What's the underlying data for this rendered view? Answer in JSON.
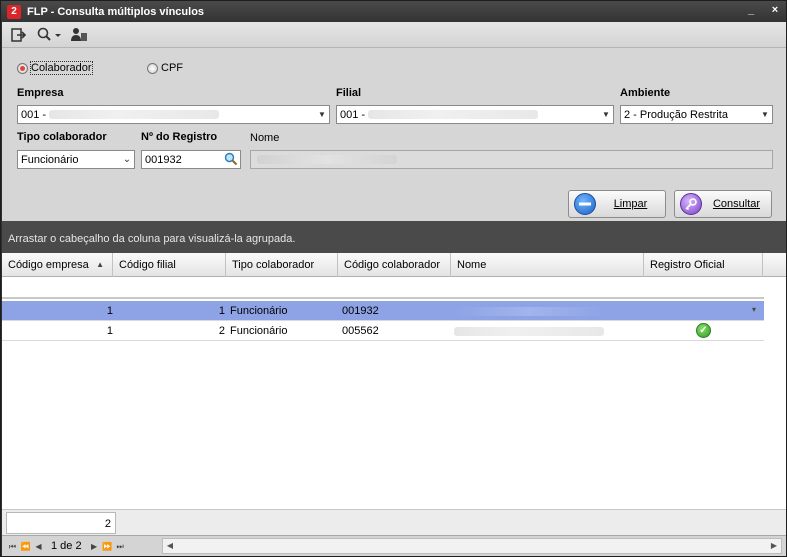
{
  "window": {
    "title": "FLP - Consulta múltiplos vínculos",
    "app_icon_letter": "2",
    "minimize": "_",
    "close": "×"
  },
  "toolbar": {
    "icons": [
      "exit-icon",
      "search-dropdown-icon",
      "user-icon"
    ]
  },
  "search_mode": {
    "options": [
      {
        "label": "Colaborador",
        "selected": true
      },
      {
        "label": "CPF",
        "selected": false
      }
    ]
  },
  "fields": {
    "empresa": {
      "label": "Empresa",
      "value": "001 -"
    },
    "filial": {
      "label": "Filial",
      "value": "001 -"
    },
    "ambiente": {
      "label": "Ambiente",
      "value": "2 - Produção Restrita"
    },
    "tipo_colaborador": {
      "label": "Tipo colaborador",
      "value": "Funcionário"
    },
    "numero_registro": {
      "label": "Nº do Registro",
      "value": "001932"
    },
    "nome": {
      "label": "Nome",
      "value": ""
    }
  },
  "buttons": {
    "limpar": "Limpar",
    "consultar": "Consultar"
  },
  "grid": {
    "group_hint": "Arrastar o cabeçalho da coluna para visualizá-la agrupada.",
    "columns": [
      "Código empresa",
      "Código filial",
      "Tipo colaborador",
      "Código colaborador",
      "Nome",
      "Registro Oficial"
    ],
    "sorted_column": "Código empresa",
    "sort_direction": "ascending",
    "rows": [
      {
        "codigo_empresa": "1",
        "codigo_filial": "1",
        "tipo_colaborador": "Funcionário",
        "codigo_colaborador": "001932",
        "nome": "",
        "registro_oficial": false,
        "selected": true
      },
      {
        "codigo_empresa": "1",
        "codigo_filial": "2",
        "tipo_colaborador": "Funcionário",
        "codigo_colaborador": "005562",
        "nome": "",
        "registro_oficial": true,
        "selected": false
      }
    ],
    "row_count": "2"
  },
  "pager": {
    "page_text": "1 de 2"
  },
  "colors": {
    "selected_row": "#8ea3e6",
    "title_bar": "#3c3c3c",
    "panel": "#d6d6d6",
    "ok_green": "#2f9a26"
  }
}
